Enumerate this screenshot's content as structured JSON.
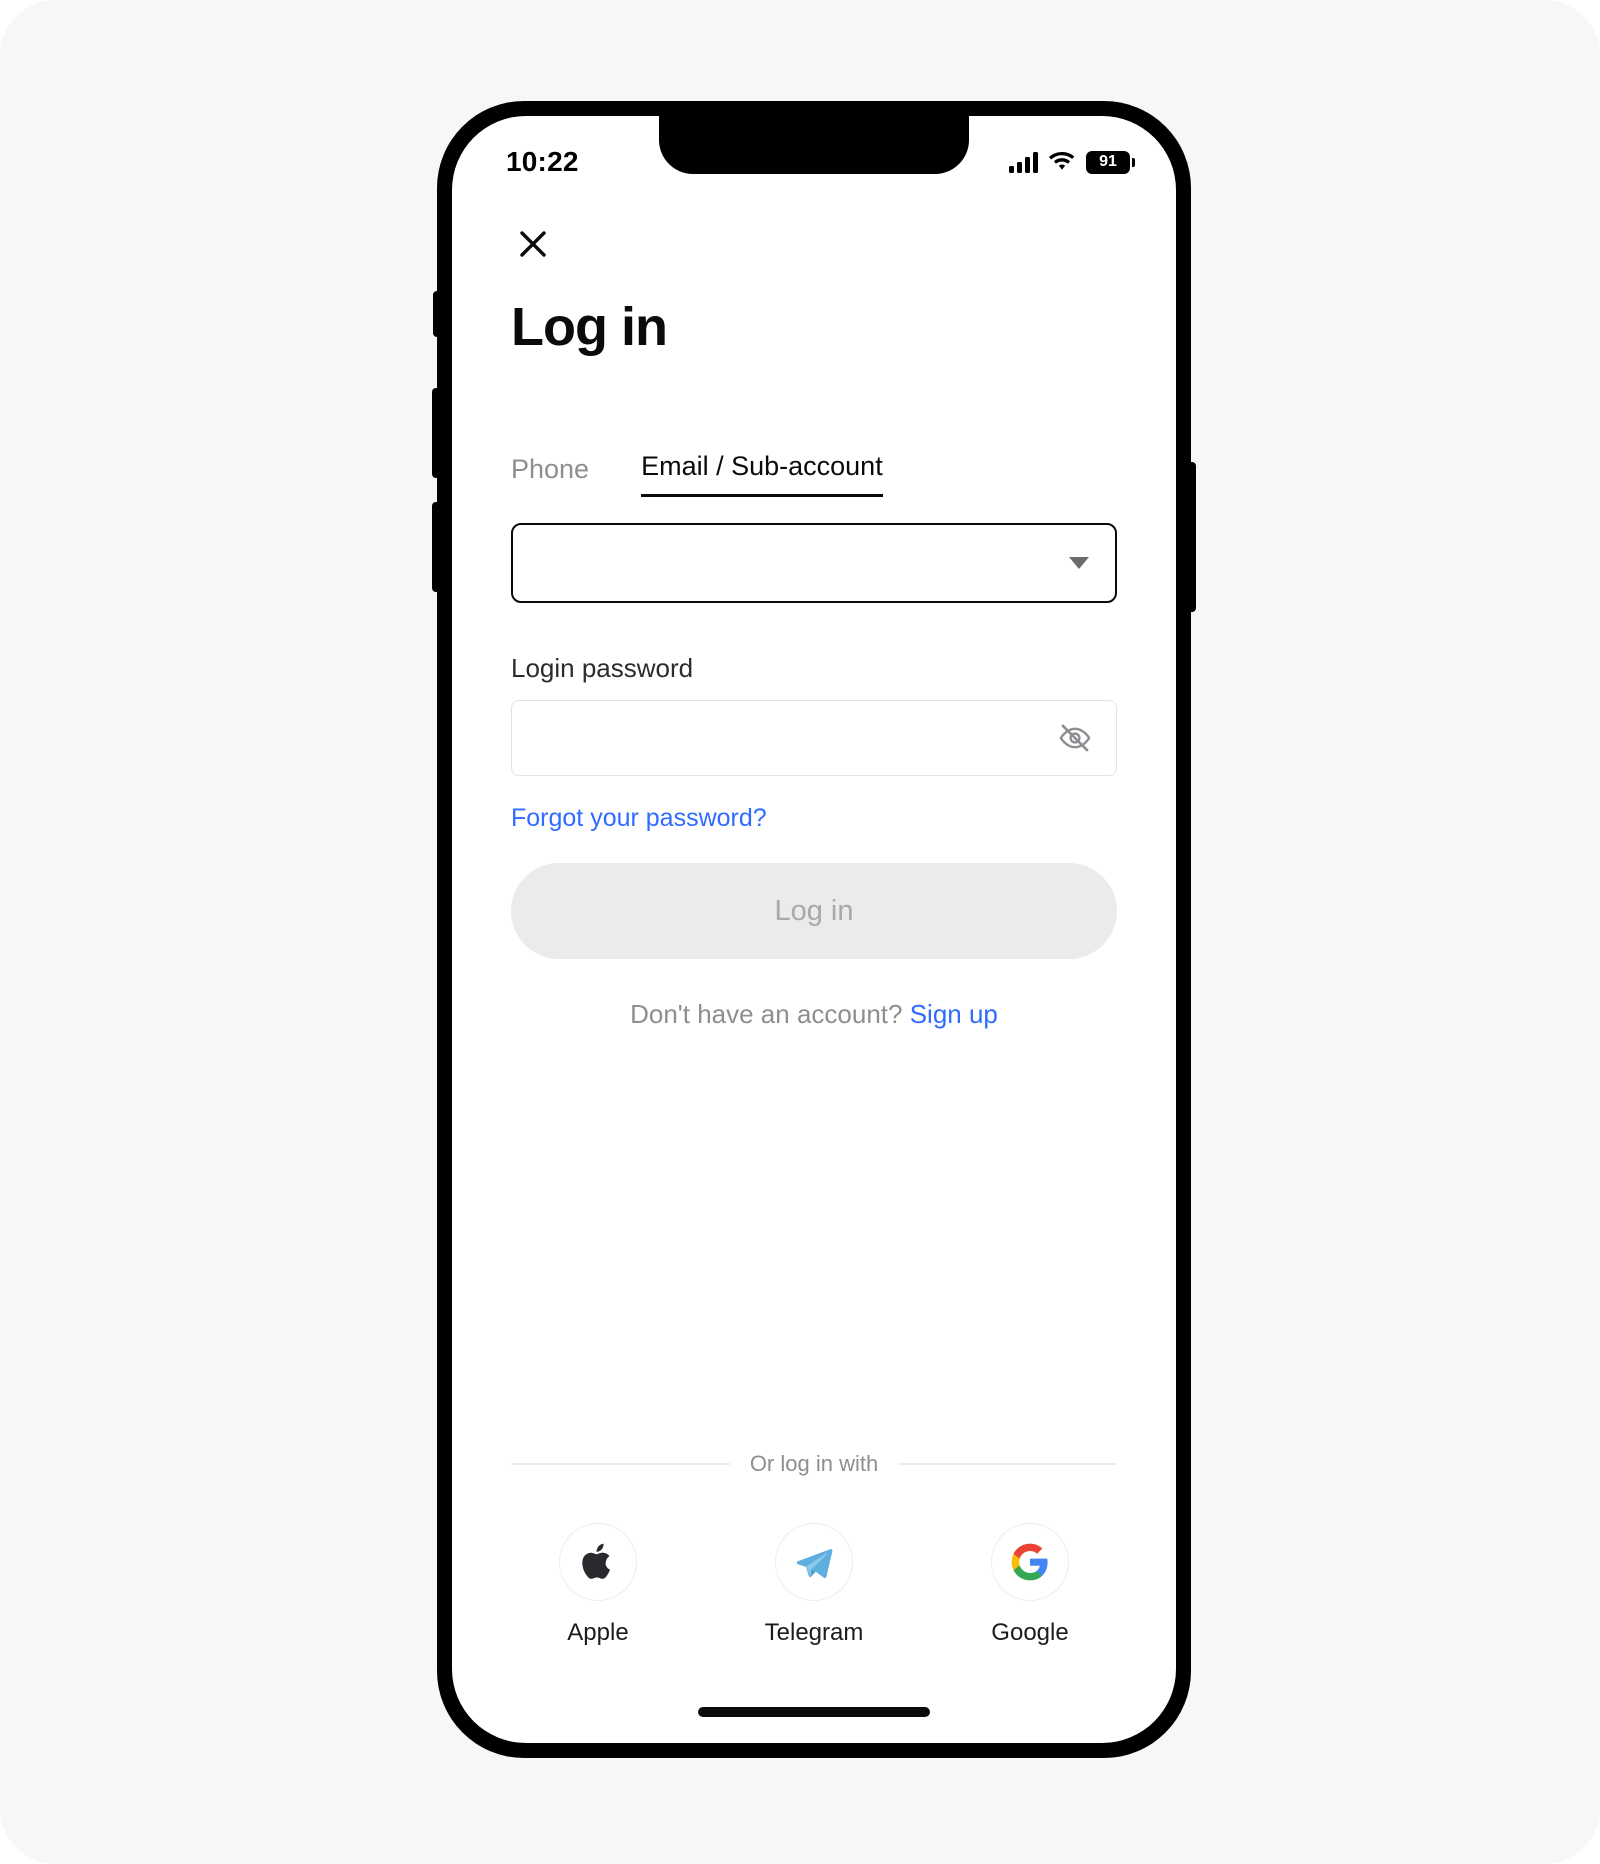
{
  "status_bar": {
    "time": "10:22",
    "signal_icon": "cellular-signal-icon",
    "wifi_icon": "wifi-icon",
    "battery_level": "91"
  },
  "header": {
    "close_icon": "close-icon",
    "title": "Log in"
  },
  "tabs": [
    {
      "label": "Phone",
      "active": false
    },
    {
      "label": "Email / Sub-account",
      "active": true
    }
  ],
  "account_select": {
    "value": "",
    "placeholder": "",
    "caret_icon": "chevron-down-icon"
  },
  "password": {
    "label": "Login password",
    "value": "",
    "placeholder": "",
    "toggle_icon": "eye-off-icon"
  },
  "forgot_password": {
    "label": "Forgot your password?"
  },
  "submit": {
    "label": "Log in",
    "disabled": true
  },
  "signup": {
    "prompt": "Don't have an account? ",
    "link_label": "Sign up"
  },
  "social": {
    "divider_label": "Or log in with",
    "providers": [
      {
        "label": "Apple",
        "icon": "apple-icon"
      },
      {
        "label": "Telegram",
        "icon": "telegram-icon"
      },
      {
        "label": "Google",
        "icon": "google-icon"
      }
    ]
  },
  "colors": {
    "link_blue": "#2f6bff",
    "text_primary": "#0b0b0d",
    "text_muted": "#8e8e93",
    "button_disabled_bg": "#ebebeb",
    "telegram_blue": "#5eaee0",
    "google_red": "#ea4335",
    "google_yellow": "#fbbc05",
    "google_green": "#34a853",
    "google_blue": "#4285f4"
  }
}
